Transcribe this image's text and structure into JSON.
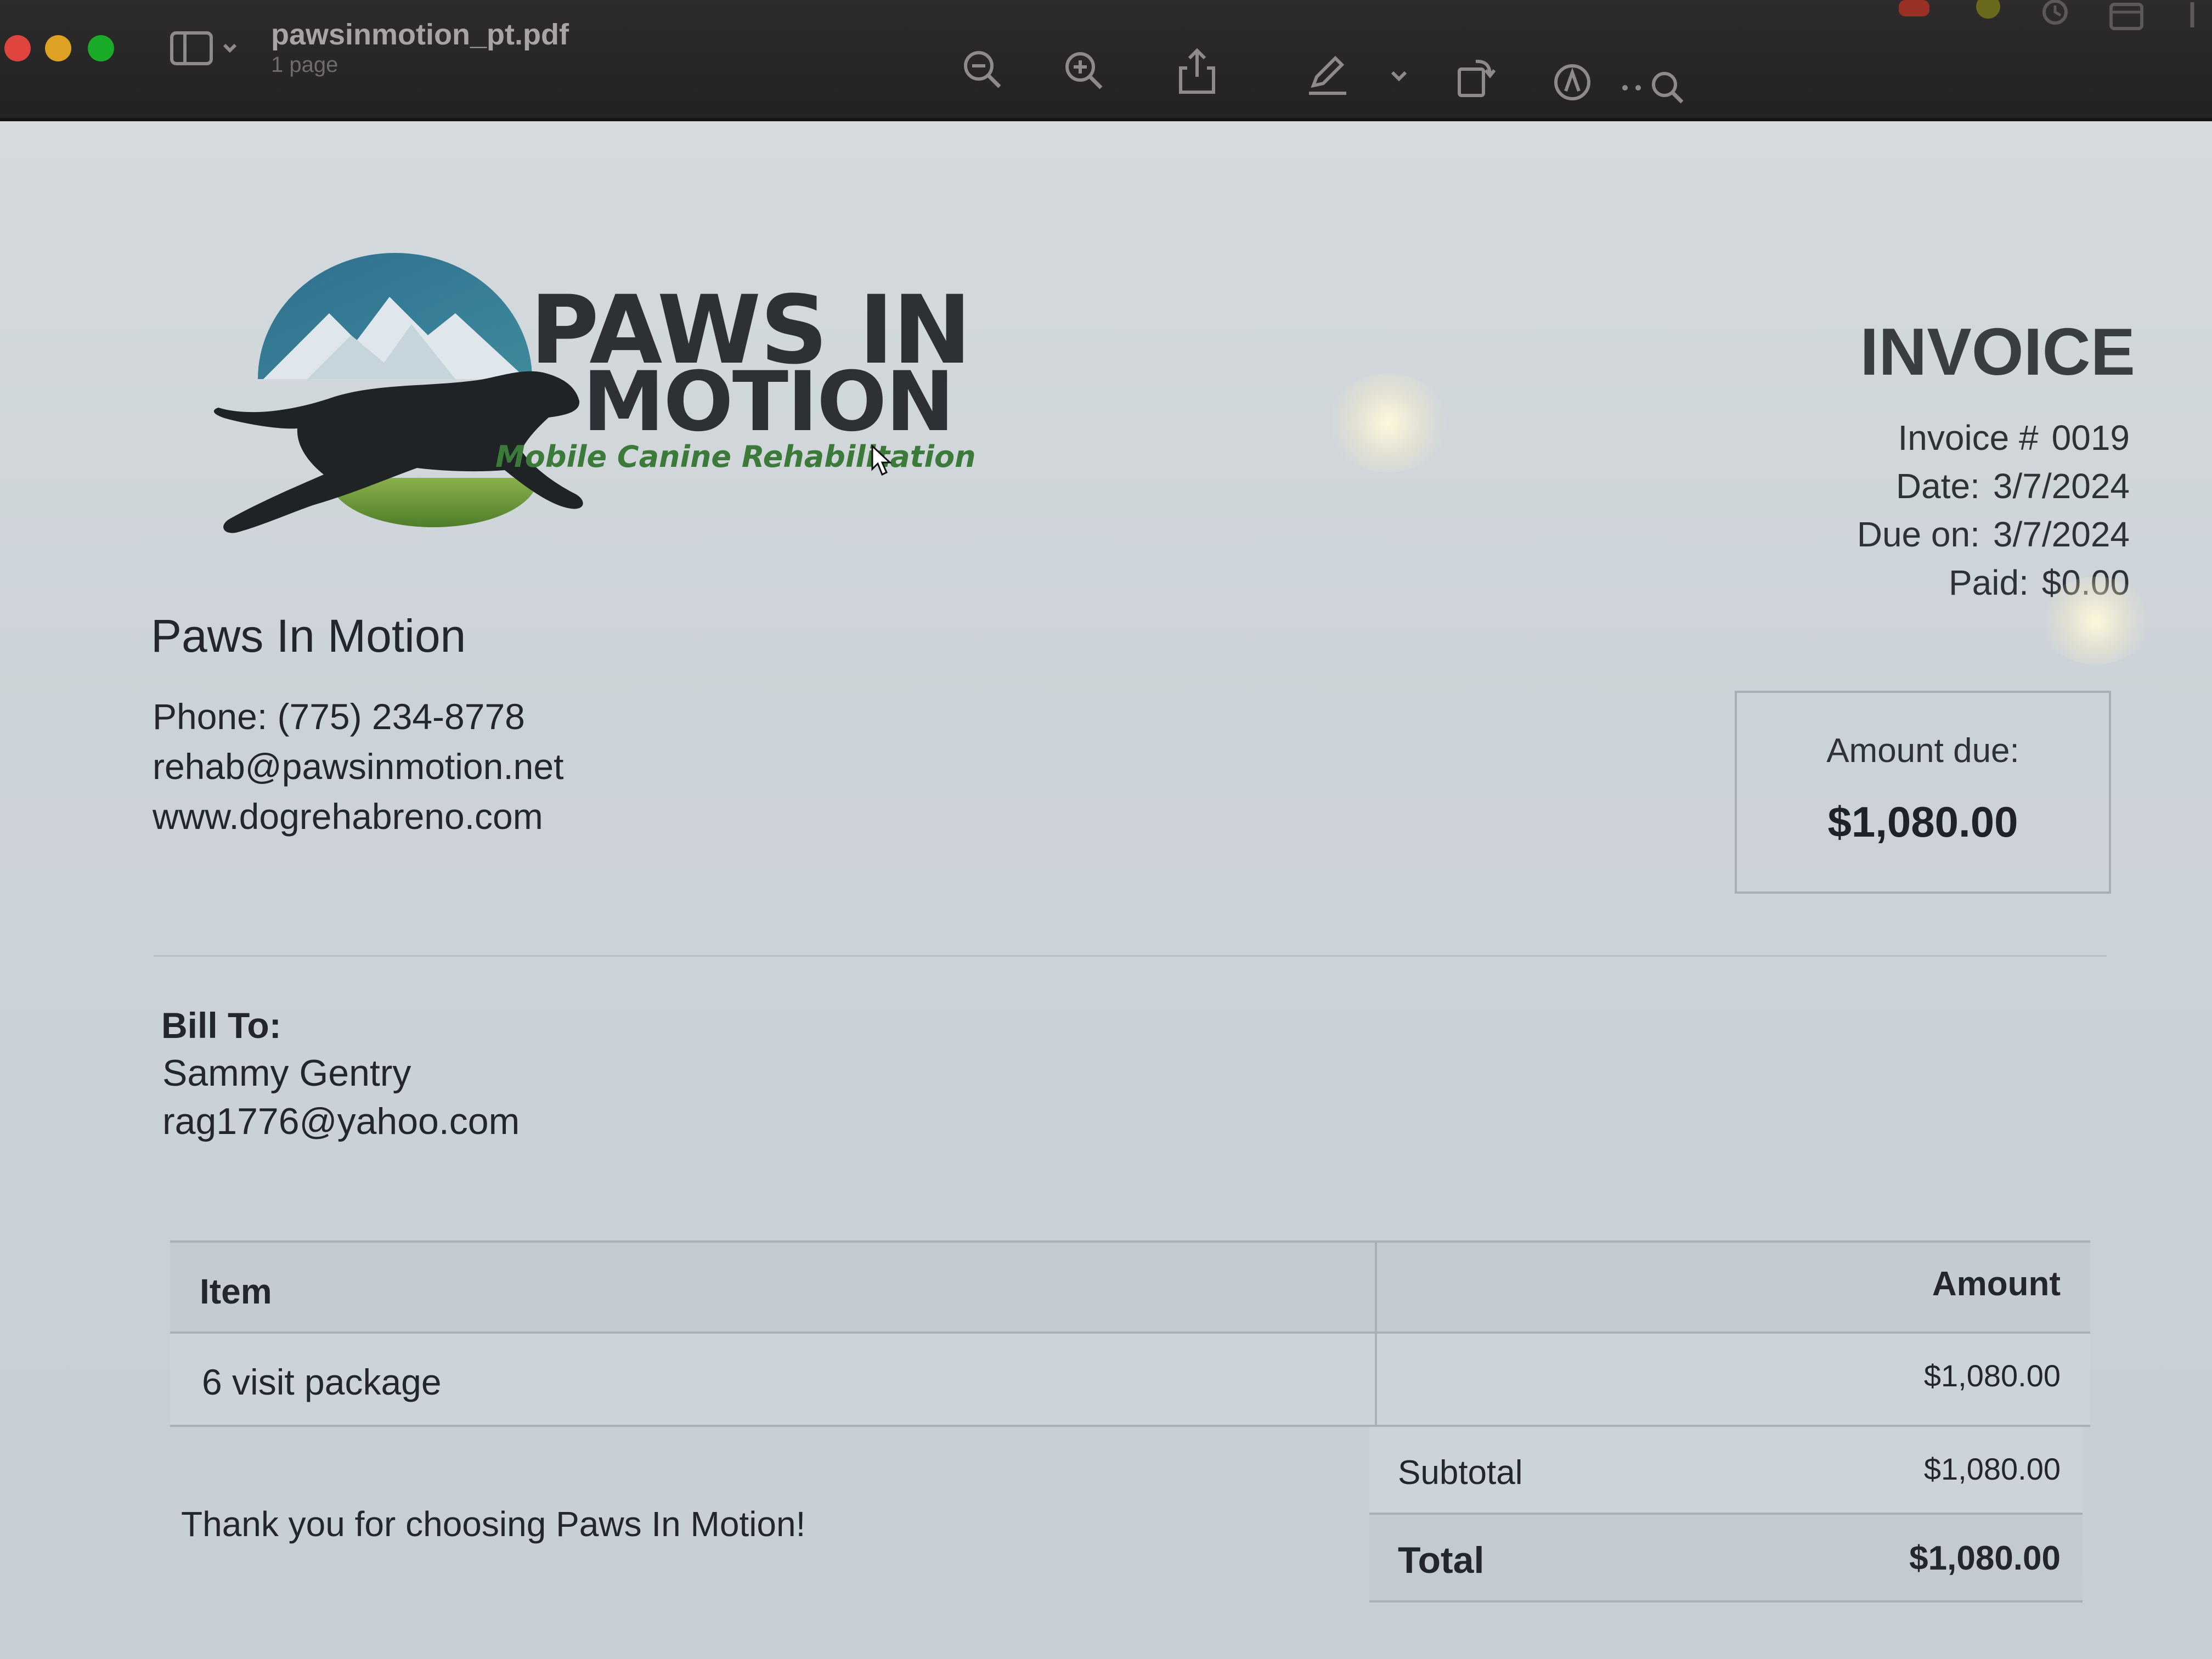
{
  "window": {
    "file_name": "pawsinmotion_pt.pdf",
    "page_count": "1 page",
    "traffic_lights": {
      "close": "#e0443e",
      "minimize": "#dea123",
      "zoom": "#1aab29"
    }
  },
  "toolbar": {
    "icons": [
      "sidebar-toggle-icon",
      "zoom-out-icon",
      "zoom-in-icon",
      "share-icon",
      "markup-pen-icon",
      "rotate-icon",
      "annotate-icon",
      "search-icon"
    ]
  },
  "company": {
    "logo_line_1": "PAWS IN",
    "logo_line_2": "MOTION",
    "logo_tagline": "Mobile Canine Rehabilitation",
    "name": "Paws In Motion",
    "phone": "Phone: (775) 234-8778",
    "email": "rehab@pawsinmotion.net",
    "website": "www.dogrehabreno.com",
    "brand_colors": {
      "mountain_blue": "#2f6f8f",
      "hill_green": "#6c9a3c",
      "tagline_green": "#3c7a3a",
      "dark": "#2d3136"
    }
  },
  "invoice": {
    "title": "INVOICE",
    "number_label": "Invoice #",
    "number": "0019",
    "date_label": "Date:",
    "date": "3/7/2024",
    "due_label": "Due on:",
    "due": "3/7/2024",
    "paid_label": "Paid:",
    "paid": "$0.00",
    "amount_due_label": "Amount due:",
    "amount_due": "$1,080.00"
  },
  "bill_to": {
    "label": "Bill To:",
    "name": "Sammy Gentry",
    "email": "rag1776@yahoo.com"
  },
  "table": {
    "headers": {
      "item": "Item",
      "amount": "Amount"
    },
    "rows": [
      {
        "item": "6 visit package",
        "amount": "$1,080.00"
      }
    ]
  },
  "totals": {
    "subtotal_label": "Subtotal",
    "subtotal": "$1,080.00",
    "total_label": "Total",
    "total": "$1,080.00"
  },
  "footer": {
    "thanks": "Thank you for choosing Paws In Motion!"
  }
}
